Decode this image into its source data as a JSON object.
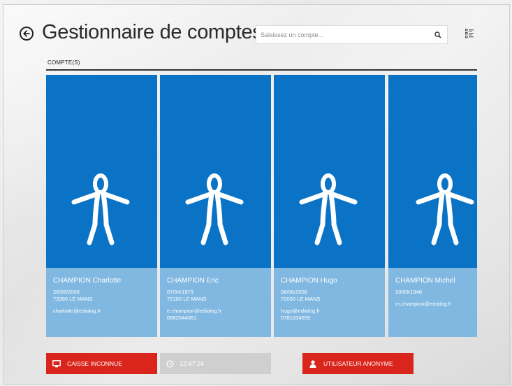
{
  "header": {
    "title": "Gestionnaire de comptes",
    "search_placeholder": "Saisissez un compte..."
  },
  "section": {
    "label": "COMPTE(S)"
  },
  "accounts": [
    {
      "name": "CHAMPION Charlotte",
      "birthdate": "26/05/2006",
      "city": "72000 LE MANS",
      "email": "charlotte@edialog.fr",
      "phone": ""
    },
    {
      "name": "CHAMPION Eric",
      "birthdate": "07/04/1973",
      "city": "72100 LE MANS",
      "email": "e.champion@edialog.fr",
      "phone": "0662644061"
    },
    {
      "name": "CHAMPION Hugo",
      "birthdate": "08/06/2006",
      "city": "72000 LE MANS",
      "email": "hugo@edialog.fr",
      "phone": "0781634559"
    },
    {
      "name": "CHAMPION Michel",
      "birthdate": "20/09/1948",
      "city": "",
      "email": "m.champion@edialog.fr",
      "phone": ""
    }
  ],
  "footer": {
    "register_label": "CAISSE INCONNUE",
    "time": "12:47:24",
    "anonymous_label": "UTILISATEUR ANONYME"
  },
  "colors": {
    "card_top": "#0a73c6",
    "card_bottom": "#80b8e1",
    "accent_red": "#d9251c"
  },
  "icons": [
    "back-arrow-icon",
    "search-icon",
    "list-view-icon",
    "person-icon",
    "monitor-icon",
    "clock-icon",
    "user-icon"
  ]
}
